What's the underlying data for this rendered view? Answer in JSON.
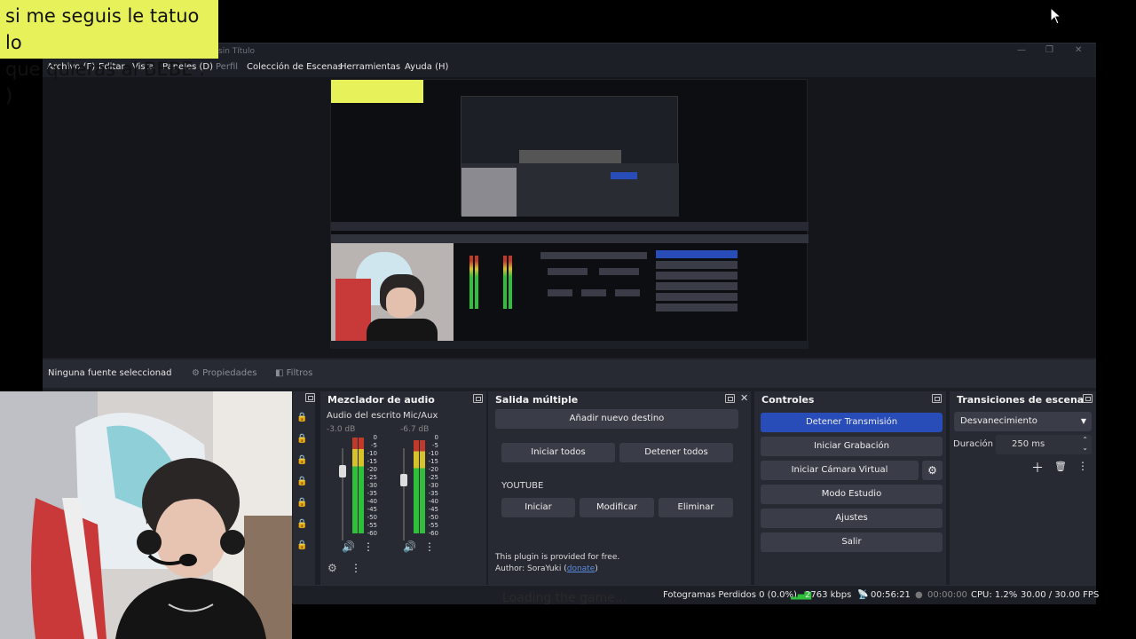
{
  "overlay": {
    "banner_line1": "si me seguis le tatuo lo",
    "banner_line2": "que quieras al BEBE : )"
  },
  "window": {
    "title": "sin Título",
    "minimize": "—",
    "maximize": "❐",
    "close": "✕"
  },
  "menu": [
    "Archivo (F)",
    "Editar",
    "Vista",
    "Paneles (D)",
    "Perfil",
    "Colección de Escenas",
    "Herramientas",
    "Ayuda (H)"
  ],
  "source_bar": {
    "no_source": "Ninguna fuente seleccionad",
    "properties": "Propiedades",
    "filters": "Filtros"
  },
  "audio_mixer": {
    "title": "Mezclador de audio",
    "channels": [
      {
        "name": "Audio del escrito",
        "db": "-3.0 dB",
        "level": 0.98,
        "volume": 0.82
      },
      {
        "name": "Mic/Aux",
        "db": "-6.7 dB",
        "level": 0.95,
        "volume": 0.72
      }
    ],
    "ticks": [
      "0",
      "-5",
      "-10",
      "-15",
      "-20",
      "-25",
      "-30",
      "-35",
      "-40",
      "-45",
      "-50",
      "-55",
      "-60"
    ]
  },
  "multi_output": {
    "title": "Salida múltiple",
    "add_destination": "Añadir nuevo destino",
    "start_all": "Iniciar todos",
    "stop_all": "Detener todos",
    "platform": "YOUTUBE",
    "start": "Iniciar",
    "modify": "Modificar",
    "delete": "Eliminar",
    "plugin_note": "This plugin is provided for free.",
    "author_prefix": "Author: SoraYuki (",
    "donate": "donate",
    "author_suffix": ")"
  },
  "controls": {
    "title": "Controles",
    "stop_stream": "Detener Transmisión",
    "start_recording": "Iniciar Grabación",
    "start_virtual_cam": "Iniciar Cámara Virtual",
    "studio_mode": "Modo Estudio",
    "settings": "Ajustes",
    "exit": "Salir"
  },
  "transitions": {
    "title": "Transiciones de escena",
    "selected": "Desvanecimiento",
    "duration_label": "Duración",
    "duration_value": "250 ms"
  },
  "status": {
    "dropped_frames": "Fotogramas Perdidos 0 (0.0%)",
    "bitrate": "2763 kbps",
    "stream_time": "00:56:21",
    "record_time": "00:00:00",
    "cpu": "CPU: 1.2%",
    "fps": "30.00 / 30.00 FPS"
  },
  "background_text": "Loading the game...",
  "colors": {
    "banner_bg": "#e7f25a",
    "accent_blue": "#284cb8",
    "panel_bg": "#272a33",
    "window_bg": "#1d1f26",
    "meter_green": "#2fbf3a",
    "meter_yellow": "#d8c22a",
    "meter_red": "#c0392b"
  }
}
